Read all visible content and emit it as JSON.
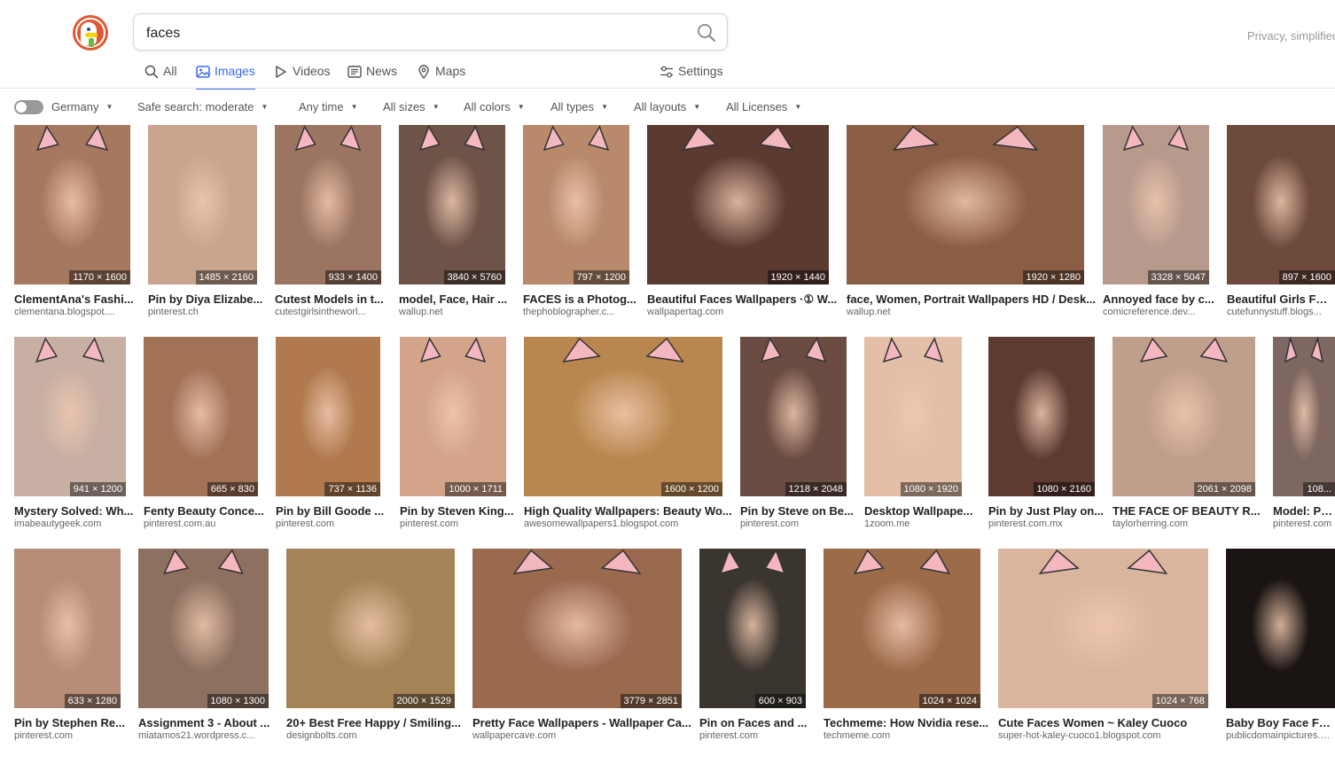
{
  "search": {
    "query": "faces"
  },
  "tagline": "Privacy, simplified.",
  "tabs": [
    {
      "label": "All",
      "icon": "search-icon"
    },
    {
      "label": "Images",
      "icon": "image-icon",
      "active": true
    },
    {
      "label": "Videos",
      "icon": "play-icon"
    },
    {
      "label": "News",
      "icon": "newspaper-icon"
    },
    {
      "label": "Maps",
      "icon": "map-pin-icon"
    },
    {
      "label": "Settings",
      "icon": "sliders-icon"
    }
  ],
  "filters": {
    "region": "Germany",
    "safe_search": "Safe search: moderate",
    "time": "Any time",
    "size": "All sizes",
    "color": "All colors",
    "type": "All types",
    "layout": "All layouts",
    "license": "All Licenses"
  },
  "colors": {
    "accent": "#3969ef",
    "brand": "#de5833"
  },
  "results": [
    [
      {
        "title": "ClementAna's Fashi...",
        "source": "clementana.blogspot....",
        "dims": "1170 × 1600",
        "bg": "#a67860",
        "ears": true
      },
      {
        "title": "Pin by Diya Elizabe...",
        "source": "pinterest.ch",
        "dims": "1485 × 2160",
        "bg": "#c9a58f"
      },
      {
        "title": "Cutest Models in t...",
        "source": "cutestgirlsintheworl...",
        "dims": "933 × 1400",
        "bg": "#9b7462",
        "ears": true
      },
      {
        "title": "model, Face, Hair ...",
        "source": "wallup.net",
        "dims": "3840 × 5760",
        "bg": "#6e5448",
        "ears": true
      },
      {
        "title": "FACES is a Photog...",
        "source": "thephoblographer.c...",
        "dims": "797 × 1200",
        "bg": "#b88a6b",
        "ears": true
      },
      {
        "title": "Beautiful Faces Wallpapers ·① W...",
        "source": "wallpapertag.com",
        "dims": "1920 × 1440",
        "bg": "#5b3a30",
        "ears": true
      },
      {
        "title": "face, Women, Portrait Wallpapers HD / Desk...",
        "source": "wallup.net",
        "dims": "1920 × 1280",
        "bg": "#8a5e44",
        "ears": true
      },
      {
        "title": "Annoyed face by c...",
        "source": "comicreference.dev...",
        "dims": "3328 × 5047",
        "bg": "#b89a8c",
        "ears": true
      },
      {
        "title": "Beautiful Girls Fac...",
        "source": "cutefunnystuff.blogs...",
        "dims": "897 × 1600",
        "bg": "#6d4a3c"
      }
    ],
    [
      {
        "title": "Mystery Solved: Wh...",
        "source": "imabeautygeek.com",
        "dims": "941 × 1200",
        "bg": "#c7b0a3",
        "ears": true
      },
      {
        "title": "Fenty Beauty Conce...",
        "source": "pinterest.com.au",
        "dims": "665 × 830",
        "bg": "#a27256"
      },
      {
        "title": "Pin by Bill Goode ...",
        "source": "pinterest.com",
        "dims": "737 × 1136",
        "bg": "#b07a4e"
      },
      {
        "title": "Pin by Steven King...",
        "source": "pinterest.com",
        "dims": "1000 × 1711",
        "bg": "#d3a48a",
        "ears": true
      },
      {
        "title": "High Quality Wallpapers: Beauty Wo...",
        "source": "awesomewallpapers1.blogspot.com",
        "dims": "1600 × 1200",
        "bg": "#b8864e",
        "ears": true
      },
      {
        "title": "Pin by Steve on Be...",
        "source": "pinterest.com",
        "dims": "1218 × 2048",
        "bg": "#6b4c42",
        "ears": true
      },
      {
        "title": "Desktop Wallpape...",
        "source": "1zoom.me",
        "dims": "1080 × 1920",
        "bg": "#e2bfa6",
        "ears": true
      },
      {
        "title": "Pin by Just Play on...",
        "source": "pinterest.com.mx",
        "dims": "1080 × 2160",
        "bg": "#5d3b31"
      },
      {
        "title": "THE FACE OF BEAUTY R...",
        "source": "taylorherring.com",
        "dims": "2061 × 2098",
        "bg": "#c09e8c",
        "ears": true
      },
      {
        "title": "Model: Patr...",
        "source": "pinterest.com",
        "dims": "108...",
        "bg": "#7e6760",
        "ears": true
      }
    ],
    [
      {
        "title": "Pin by Stephen Re...",
        "source": "pinterest.com",
        "dims": "633 × 1280",
        "bg": "#b58d78"
      },
      {
        "title": "Assignment 3 - About ...",
        "source": "miatamos21.wordpress.c...",
        "dims": "1080 × 1300",
        "bg": "#8d705f",
        "ears": true
      },
      {
        "title": "20+ Best Free Happy / Smiling...",
        "source": "designbolts.com",
        "dims": "2000 × 1529",
        "bg": "#a48356"
      },
      {
        "title": "Pretty Face Wallpapers - Wallpaper Ca...",
        "source": "wallpapercave.com",
        "dims": "3779 × 2851",
        "bg": "#9a6a4f",
        "ears": true
      },
      {
        "title": "Pin on Faces and ...",
        "source": "pinterest.com",
        "dims": "600 × 903",
        "bg": "#3b3530",
        "ears": true
      },
      {
        "title": "Techmeme: How Nvidia rese...",
        "source": "techmeme.com",
        "dims": "1024 × 1024",
        "bg": "#9c6b4a",
        "ears": true
      },
      {
        "title": "Cute Faces Women ~ Kaley Cuoco",
        "source": "super-hot-kaley-cuoco1.blogspot.com",
        "dims": "1024 × 768",
        "bg": "#d9b59e",
        "ears": true
      },
      {
        "title": "Baby Boy Face Free S...",
        "source": "publicdomainpictures.n...",
        "dims": "",
        "bg": "#1a1412"
      }
    ]
  ]
}
